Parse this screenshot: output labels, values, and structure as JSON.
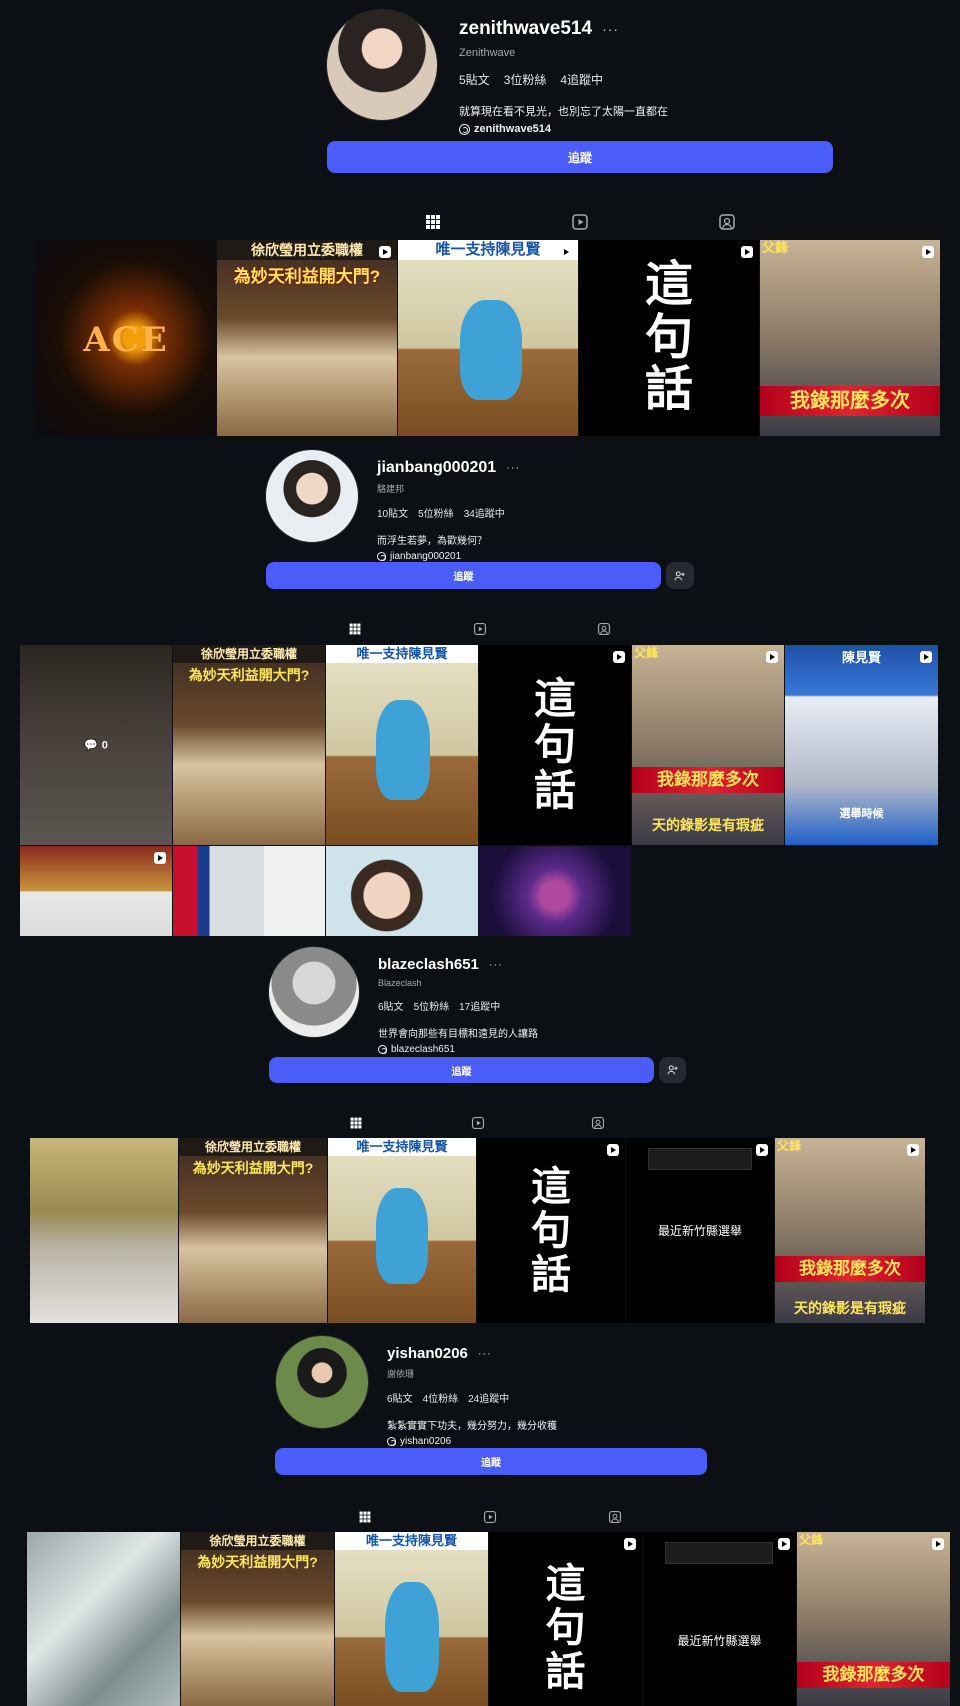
{
  "profiles": [
    {
      "username": "zenithwave514",
      "full_name": "Zenithwave",
      "posts": "5貼文",
      "followers": "3位粉絲",
      "following": "4追蹤中",
      "bio": "就算現在看不見光，也別忘了太陽一直都在",
      "threads": "zenithwave514",
      "follow_label": "追蹤"
    },
    {
      "username": "jianbang000201",
      "full_name": "駱建邦",
      "posts": "10貼文",
      "followers": "5位粉絲",
      "following": "34追蹤中",
      "bio": "而浮生若夢，為歡幾何？",
      "threads": "jianbang000201",
      "follow_label": "追蹤"
    },
    {
      "username": "blazeclash651",
      "full_name": "Blazeclash",
      "posts": "6貼文",
      "followers": "5位粉絲",
      "following": "17追蹤中",
      "bio": "世界會向那些有目標和遠見的人讓路",
      "threads": "blazeclash651",
      "follow_label": "追蹤"
    },
    {
      "username": "yishan0206",
      "full_name": "謝依珊",
      "posts": "6貼文",
      "followers": "4位粉絲",
      "following": "24追蹤中",
      "bio": "紮紮實實下功夫，幾分努力，幾分收穫",
      "threads": "yishan0206",
      "follow_label": "追蹤"
    }
  ],
  "more_glyph": "···",
  "tiles": {
    "poster_title": "徐欣瑩用立委職權",
    "poster_subtitle": "為妙天利益開大門?",
    "fish_title": "唯一支持陳見賢",
    "this_sentence": [
      "這",
      "句",
      "話"
    ],
    "recorded": "我錄那麼多次",
    "recorded_top": "父鋒",
    "recent_election": "最近新竹縣選舉",
    "ace": "ACE",
    "comment_count": "0",
    "flaw": "天的錄影是有瑕疵",
    "election_time": "選舉時候",
    "chen": "陳見賢"
  },
  "colors": {
    "background": "#0c1014",
    "follow_button": "#4a5df9",
    "secondary_button": "#262a30"
  },
  "icons": [
    "grid-icon",
    "reels-icon",
    "tagged-icon",
    "more-icon",
    "threads-icon",
    "add-person-icon",
    "reel-badge-icon"
  ]
}
